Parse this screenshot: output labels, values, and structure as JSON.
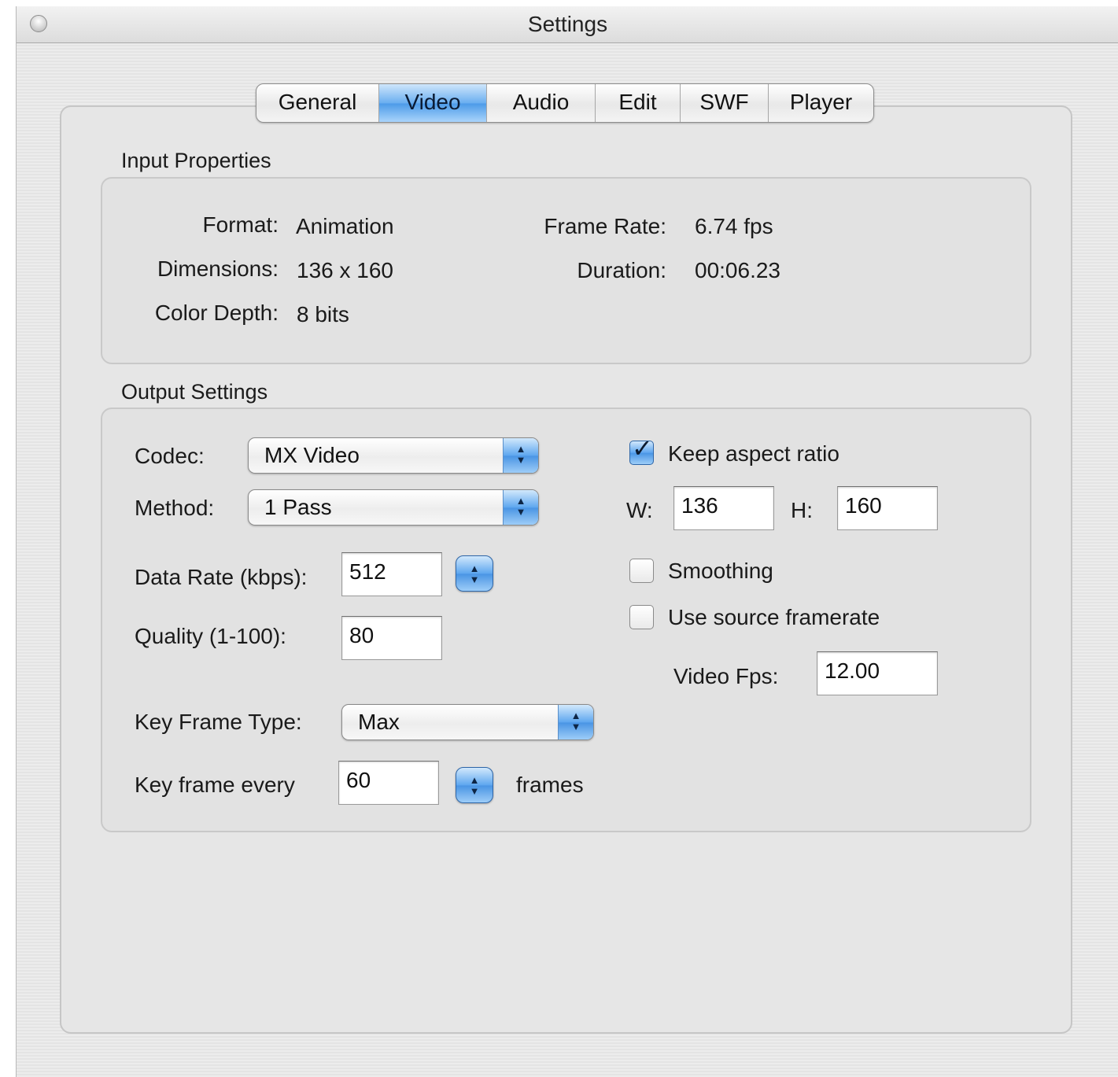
{
  "window": {
    "title": "Settings"
  },
  "tabs": [
    {
      "label": "General",
      "active": false
    },
    {
      "label": "Video",
      "active": true
    },
    {
      "label": "Audio",
      "active": false
    },
    {
      "label": "Edit",
      "active": false
    },
    {
      "label": "SWF",
      "active": false
    },
    {
      "label": "Player",
      "active": false
    }
  ],
  "input_properties": {
    "title": "Input Properties",
    "format_label": "Format:",
    "format_value": "Animation",
    "dimensions_label": "Dimensions:",
    "dimensions_value": "136 x 160",
    "color_depth_label": "Color Depth:",
    "color_depth_value": "8 bits",
    "frame_rate_label": "Frame Rate:",
    "frame_rate_value": "6.74 fps",
    "duration_label": "Duration:",
    "duration_value": "00:06.23"
  },
  "output_settings": {
    "title": "Output Settings",
    "codec_label": "Codec:",
    "codec_value": "MX Video",
    "method_label": "Method:",
    "method_value": "1 Pass",
    "data_rate_label": "Data Rate (kbps):",
    "data_rate_value": "512",
    "quality_label": "Quality (1-100):",
    "quality_value": "80",
    "key_frame_type_label": "Key Frame Type:",
    "key_frame_type_value": "Max",
    "key_frame_every_label": "Key frame every",
    "key_frame_every_value": "60",
    "frames_label": "frames",
    "keep_aspect_label": "Keep aspect ratio",
    "keep_aspect_checked": true,
    "w_label": "W:",
    "w_value": "136",
    "h_label": "H:",
    "h_value": "160",
    "smoothing_label": "Smoothing",
    "smoothing_checked": false,
    "use_source_label": "Use source framerate",
    "use_source_checked": false,
    "video_fps_label": "Video Fps:",
    "video_fps_value": "12.00"
  },
  "colors": {
    "accent": "#5ea6ef",
    "window_bg": "#e6e6e6"
  },
  "icons": {
    "close": "close-icon",
    "popup": "up-down-arrows-icon",
    "check": "checkmark-icon"
  }
}
